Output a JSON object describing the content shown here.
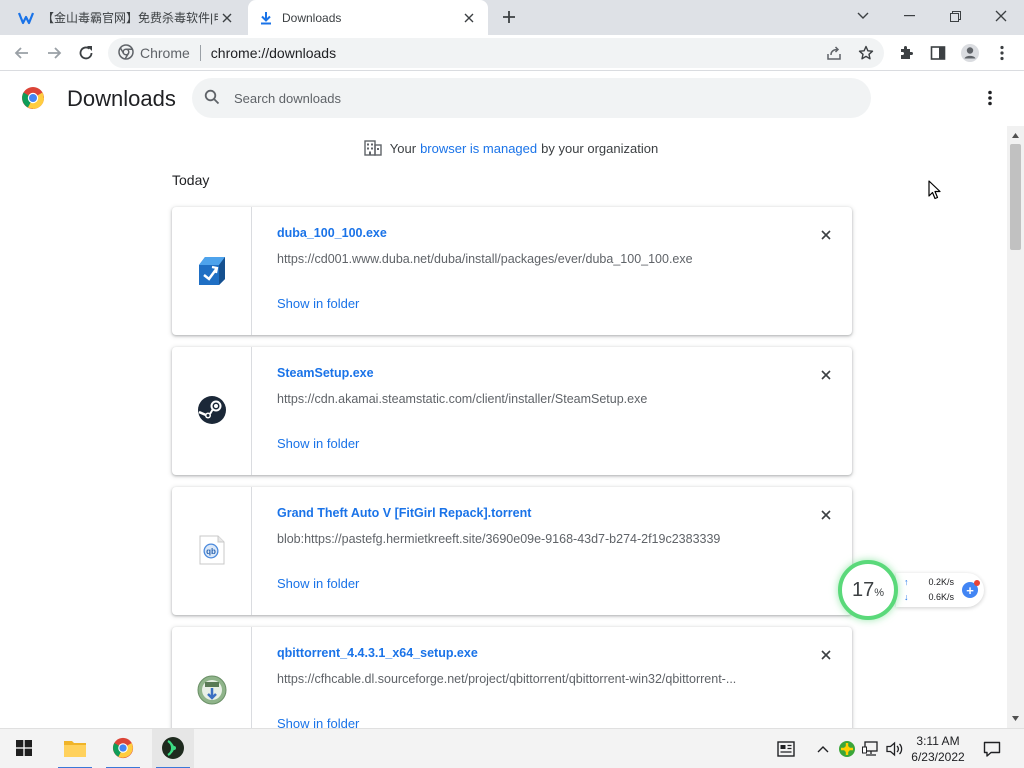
{
  "tabs": [
    {
      "title": "【金山毒霸官网】免费杀毒软件|电脑",
      "active": false
    },
    {
      "title": "Downloads",
      "active": true
    }
  ],
  "toolbar": {
    "site_label": "Chrome",
    "url": "chrome://downloads"
  },
  "page": {
    "title": "Downloads",
    "search_placeholder": "Search downloads",
    "managed_prefix": "Your",
    "managed_link": "browser is managed",
    "managed_suffix": "by your organization",
    "section_today": "Today"
  },
  "downloads": [
    {
      "name": "duba_100_100.exe",
      "url": "https://cd001.www.duba.net/duba/install/packages/ever/duba_100_100.exe",
      "action": "Show in folder",
      "icon": "duba-installer-icon"
    },
    {
      "name": "SteamSetup.exe",
      "url": "https://cdn.akamai.steamstatic.com/client/installer/SteamSetup.exe",
      "action": "Show in folder",
      "icon": "steam-icon"
    },
    {
      "name": "Grand Theft Auto V [FitGirl Repack].torrent",
      "url": "blob:https://pastefg.hermietkreeft.site/3690e09e-9168-43d7-b274-2f19c2383339",
      "action": "Show in folder",
      "icon": "qbittorrent-file-icon"
    },
    {
      "name": "qbittorrent_4.4.3.1_x64_setup.exe",
      "url": "https://cfhcable.dl.sourceforge.net/project/qbittorrent/qbittorrent-win32/qbittorrent-...",
      "action": "Show in folder",
      "icon": "qbittorrent-installer-icon"
    }
  ],
  "network_widget": {
    "percent": "17",
    "percent_sign": "%",
    "upload": "0.2K/s",
    "download": "0.6K/s"
  },
  "taskbar": {
    "time": "3:11 AM",
    "date": "6/23/2022"
  },
  "colors": {
    "accent": "#1a73e8",
    "tabstrip": "#dee1e6",
    "widget_ring": "#5ad97a"
  }
}
